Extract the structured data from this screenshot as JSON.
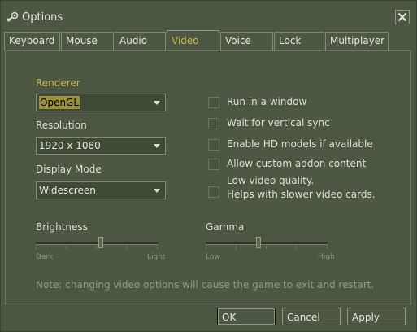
{
  "window": {
    "title": "Options",
    "close_icon": "close-icon",
    "app_icon": "steam-icon"
  },
  "tabs": [
    {
      "label": "Keyboard"
    },
    {
      "label": "Mouse"
    },
    {
      "label": "Audio"
    },
    {
      "label": "Video",
      "active": true
    },
    {
      "label": "Voice"
    },
    {
      "label": "Lock"
    },
    {
      "label": "Multiplayer"
    }
  ],
  "video": {
    "renderer": {
      "label": "Renderer",
      "value": "OpenGL"
    },
    "resolution": {
      "label": "Resolution",
      "value": "1920 x 1080"
    },
    "display_mode": {
      "label": "Display Mode",
      "value": "Widescreen"
    },
    "checkboxes": [
      {
        "label": "Run in a window",
        "checked": false
      },
      {
        "label": "Wait for vertical sync",
        "checked": false
      },
      {
        "label": "Enable HD models if available",
        "checked": false
      },
      {
        "label": "Allow custom addon content",
        "checked": false
      },
      {
        "label_line1": "Low video quality.",
        "label_line2": "Helps with slower video cards.",
        "checked": false
      }
    ],
    "brightness": {
      "label": "Brightness",
      "min_label": "Dark",
      "max_label": "Light",
      "level": 0.53
    },
    "gamma": {
      "label": "Gamma",
      "min_label": "Low",
      "max_label": "High",
      "level": 0.43
    },
    "note": "Note: changing video options will cause the game to exit and restart."
  },
  "buttons": {
    "ok": "OK",
    "cancel": "Cancel",
    "apply": "Apply"
  },
  "colors": {
    "background": "#4c5844",
    "accent": "#c4b550",
    "text": "#d8ded3"
  }
}
